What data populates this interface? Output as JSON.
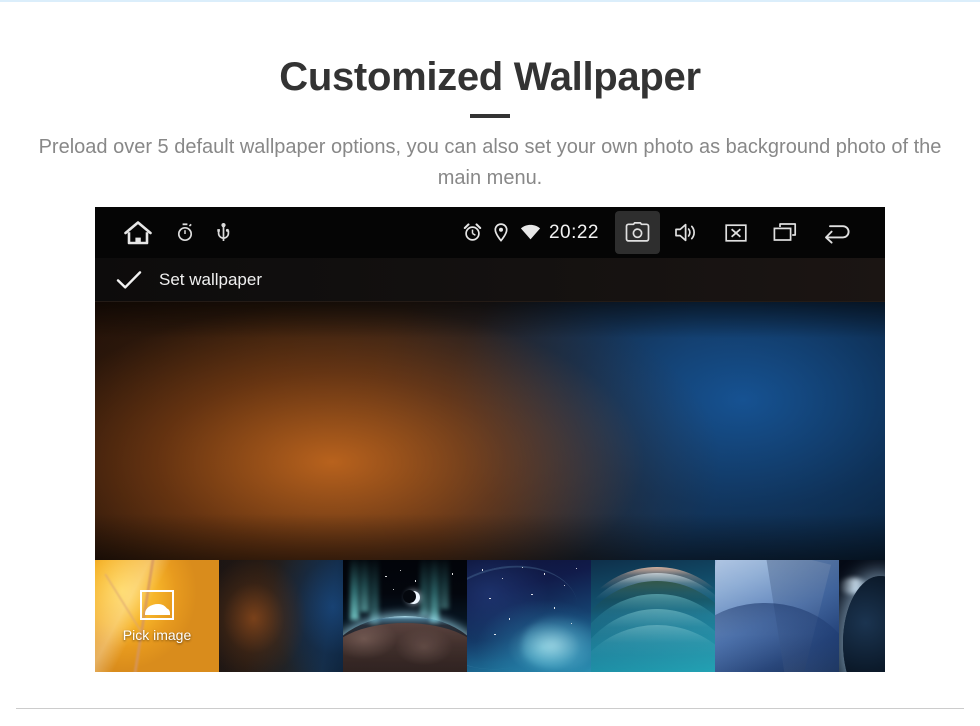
{
  "page": {
    "title": "Customized Wallpaper",
    "subtitle": "Preload over 5 default wallpaper options, you can also set your own photo as background photo of the main menu.",
    "accent_color": "#333333",
    "top_rule_color": "#dbeefb",
    "bottom_rule_color": "#cccccc"
  },
  "device": {
    "status_bar": {
      "left_icons": [
        {
          "name": "home-icon",
          "label": "Home"
        },
        {
          "name": "timer-icon",
          "label": "Timer"
        },
        {
          "name": "usb-icon",
          "label": "USB"
        }
      ],
      "right_icons": [
        {
          "name": "alarm-icon",
          "label": "Alarm"
        },
        {
          "name": "location-pin-icon",
          "label": "Location"
        },
        {
          "name": "wifi-icon",
          "label": "Wi-Fi"
        }
      ],
      "clock": "20:22",
      "nav_buttons": [
        {
          "name": "camera-icon",
          "label": "Screenshot",
          "pressed": true
        },
        {
          "name": "volume-icon",
          "label": "Volume",
          "pressed": false
        },
        {
          "name": "close-box-icon",
          "label": "Close",
          "pressed": false
        },
        {
          "name": "recent-apps-icon",
          "label": "Recent apps",
          "pressed": false
        },
        {
          "name": "back-arrow-icon",
          "label": "Back",
          "pressed": false
        }
      ],
      "background_color": "#050505"
    },
    "action_bar": {
      "confirm_icon": "check-icon",
      "label": "Set wallpaper"
    },
    "preview": {
      "description": "Blurred warm-orange to deep-blue gradient wallpaper preview",
      "selected_index": 1
    },
    "thumbnails": [
      {
        "name": "pick-image-thumb",
        "label": "Pick image",
        "icon": "picture-icon",
        "art": "autumn-leaf",
        "width": 124,
        "selected": false
      },
      {
        "name": "wallpaper-thumb-blur",
        "label": "",
        "art": "blurred-orange-blue",
        "width": 124,
        "selected": true
      },
      {
        "name": "wallpaper-thumb-aurora",
        "label": "",
        "art": "aurora-horizon-moon",
        "width": 124,
        "selected": false
      },
      {
        "name": "wallpaper-thumb-nebula",
        "label": "",
        "art": "blue-nebula-stars",
        "width": 124,
        "selected": false
      },
      {
        "name": "wallpaper-thumb-wave",
        "label": "",
        "art": "teal-wave-arc",
        "width": 124,
        "selected": false
      },
      {
        "name": "wallpaper-thumb-geometric",
        "label": "",
        "art": "blue-geometric",
        "width": 124,
        "selected": false
      },
      {
        "name": "wallpaper-thumb-eclipse",
        "label": "",
        "art": "planet-eclipse",
        "width": 50,
        "selected": false
      }
    ]
  }
}
